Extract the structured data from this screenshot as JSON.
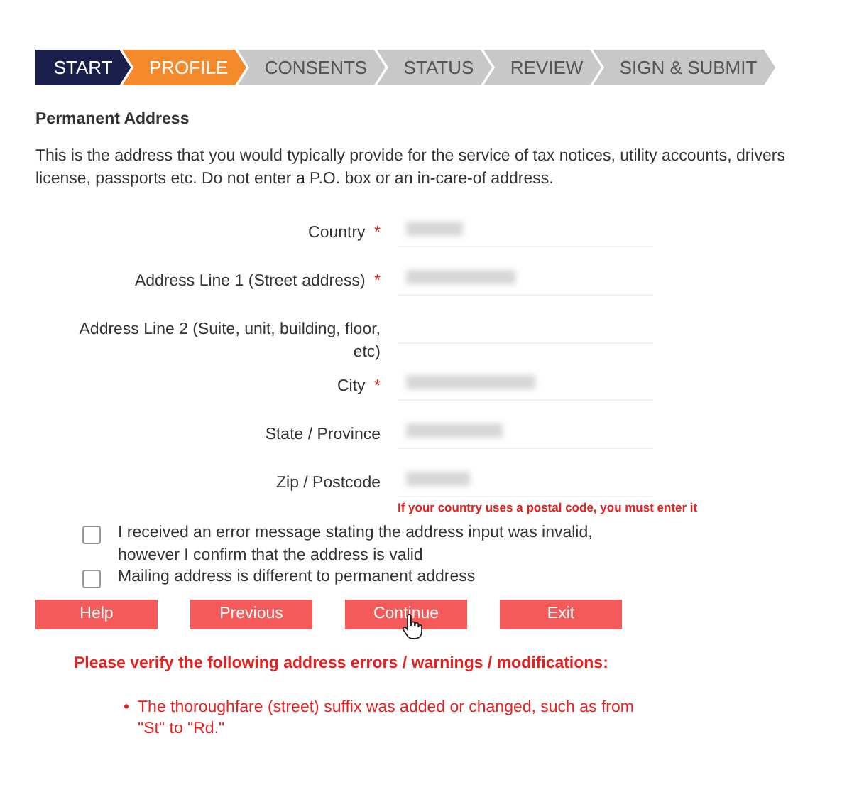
{
  "steps": [
    {
      "label": "START",
      "selected": false
    },
    {
      "label": "PROFILE",
      "selected": true
    },
    {
      "label": "CONSENTS",
      "selected": false
    },
    {
      "label": "STATUS",
      "selected": false
    },
    {
      "label": "REVIEW",
      "selected": false
    },
    {
      "label": "SIGN & SUBMIT",
      "selected": false
    }
  ],
  "heading": "Permanent Address",
  "intro": "This is the address that you would typically provide for the service of tax notices, utility accounts, drivers license, passports etc. Do not enter a P.O. box or an in-care-of address.",
  "fields": [
    {
      "label": "Country",
      "mark": "*",
      "filled": true
    },
    {
      "label": "Address Line 1 (Street address)",
      "mark": "*",
      "filled": true
    },
    {
      "label": "Address Line 2 (Suite, unit, building, floor, etc)",
      "filled": false
    },
    {
      "label": "City",
      "mark": "*",
      "filled": true
    },
    {
      "label": "State / Province",
      "filled": true
    },
    {
      "label": "Zip /  Postcode",
      "filled": true,
      "error": "If your country uses a postal code, you must enter it"
    }
  ],
  "checkboxes": [
    {
      "label": "I received an error message stating the address input was invalid, however I confirm that the address is valid",
      "checked": false
    },
    {
      "label": "Mailing address is different to permanent address",
      "checked": false
    }
  ],
  "buttons": [
    {
      "label": "Help"
    },
    {
      "label": "Previous"
    },
    {
      "label": "Continue"
    },
    {
      "label": "Exit"
    }
  ],
  "warning": {
    "title": "Please verify the following address errors / warnings / modifications:",
    "items": [
      {
        "bullet": "•",
        "text": "The thoroughfare (street) suffix was added or changed, such as from \"St\" to \"Rd.\""
      }
    ]
  }
}
